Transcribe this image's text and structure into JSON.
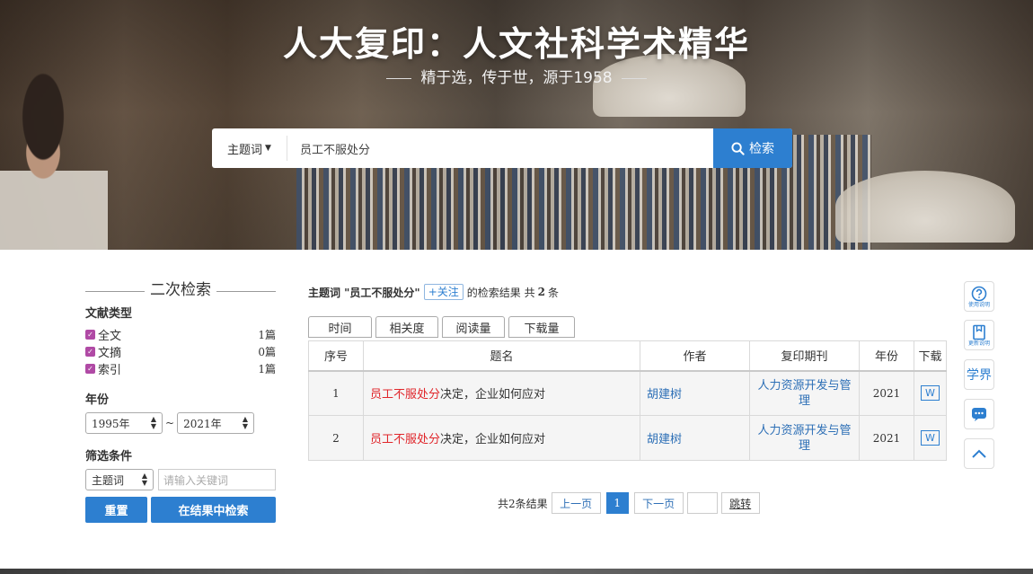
{
  "hero": {
    "title": "人大复印：人文社科学术精华",
    "subtitle": "精于选，传于世，源于1958"
  },
  "search": {
    "type_label": "主题词",
    "query": "员工不服处分",
    "button_label": "检索"
  },
  "sidebar": {
    "title": "二次检索",
    "doc_type_heading": "文献类型",
    "doc_types": [
      {
        "label": "全文",
        "count": "1篇"
      },
      {
        "label": "文摘",
        "count": "0篇"
      },
      {
        "label": "索引",
        "count": "1篇"
      }
    ],
    "year_heading": "年份",
    "year_from": "1995年",
    "year_sep": "~",
    "year_to": "2021年",
    "filter_heading": "筛选条件",
    "filter_field": "主题词",
    "keyword_placeholder": "请输入关键词",
    "reset_label": "重置",
    "search_in_results_label": "在结果中检索"
  },
  "results_header": {
    "prefix": "主题词 \"员工不服处分\"",
    "follow_label": "+关注",
    "middle": "的检索结果 共",
    "count": "2",
    "suffix": "条"
  },
  "sort_tabs": [
    "时间",
    "相关度",
    "阅读量",
    "下载量"
  ],
  "table": {
    "headers": [
      "序号",
      "题名",
      "作者",
      "复印期刊",
      "年份",
      "下载"
    ],
    "rows": [
      {
        "no": "1",
        "title_hl": "员工不服处分",
        "title_rest": "决定，企业如何应对",
        "author": "胡建树",
        "journal": "人力资源开发与管理",
        "year": "2021",
        "download": "W"
      },
      {
        "no": "2",
        "title_hl": "员工不服处分",
        "title_rest": "决定，企业如何应对",
        "author": "胡建树",
        "journal": "人力资源开发与管理",
        "year": "2021",
        "download": "W"
      }
    ]
  },
  "pager": {
    "total": "共2条结果",
    "prev": "上一页",
    "current": "1",
    "next": "下一页",
    "jump": "跳转"
  },
  "toolbar": {
    "help_caption": "使用说明",
    "update_caption": "更新说明",
    "xuejie": "学界"
  },
  "colors": {
    "accent": "#2d7fd0",
    "highlight": "#e0262b",
    "checkbox": "#b04aa5",
    "link": "#2d6fb6"
  }
}
